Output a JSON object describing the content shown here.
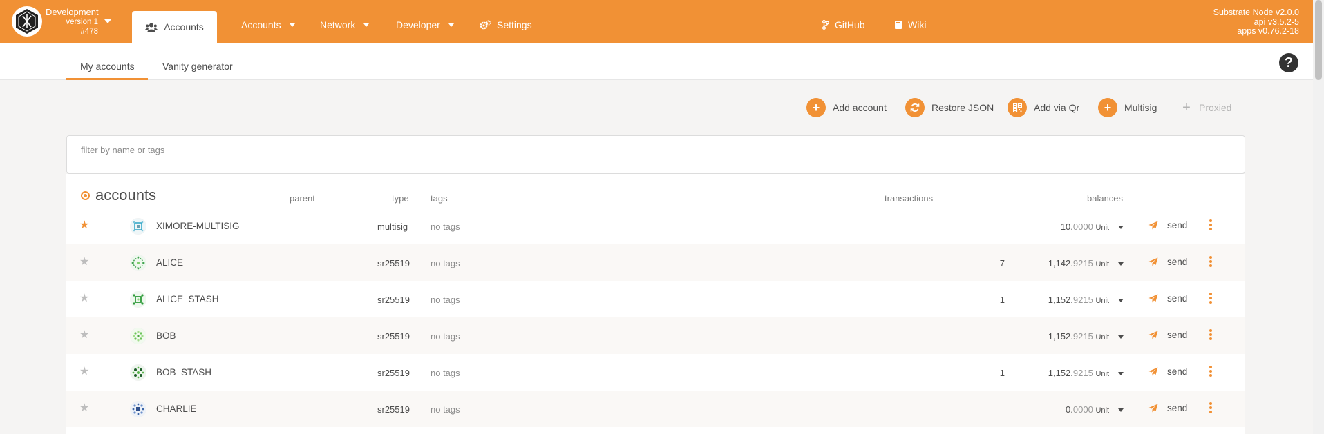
{
  "header": {
    "chain_name": "Development",
    "chain_version": "version 1",
    "chain_block": "#478",
    "nav": [
      {
        "label": "Accounts",
        "active": true
      },
      {
        "label": "Accounts"
      },
      {
        "label": "Network"
      },
      {
        "label": "Developer"
      },
      {
        "label": "Settings"
      },
      {
        "label": "GitHub"
      },
      {
        "label": "Wiki"
      }
    ],
    "node_lines": [
      "Substrate Node v2.0.0",
      "api v3.5.2-5",
      "apps v0.76.2-18"
    ]
  },
  "subtabs": [
    "My accounts",
    "Vanity generator"
  ],
  "help_label": "?",
  "actions": [
    {
      "label": "Add account",
      "icon": "plus-icon"
    },
    {
      "label": "Restore JSON",
      "icon": "sync-icon"
    },
    {
      "label": "Add via Qr",
      "icon": "qrcode-icon"
    },
    {
      "label": "Multisig",
      "icon": "plus-icon"
    },
    {
      "label": "Proxied",
      "icon": "plus-icon",
      "disabled": true
    }
  ],
  "filter": {
    "placeholder": "filter by name or tags",
    "value": ""
  },
  "table": {
    "headers": {
      "accounts": "accounts",
      "parent": "parent",
      "type": "type",
      "tags": "tags",
      "transactions": "transactions",
      "balances": "balances"
    },
    "rows": [
      {
        "name": "XIMORE-MULTISIG",
        "type": "multisig",
        "tags": "no tags",
        "transactions": "",
        "balance_int": "10.",
        "balance_dec": "0000",
        "unit": "Unit",
        "starred": true,
        "send": "send"
      },
      {
        "name": "ALICE",
        "type": "sr25519",
        "tags": "no tags",
        "transactions": "7",
        "balance_int": "1,142.",
        "balance_dec": "9215",
        "unit": "Unit",
        "starred": false,
        "send": "send"
      },
      {
        "name": "ALICE_STASH",
        "type": "sr25519",
        "tags": "no tags",
        "transactions": "1",
        "balance_int": "1,152.",
        "balance_dec": "9215",
        "unit": "Unit",
        "starred": false,
        "send": "send"
      },
      {
        "name": "BOB",
        "type": "sr25519",
        "tags": "no tags",
        "transactions": "",
        "balance_int": "1,152.",
        "balance_dec": "9215",
        "unit": "Unit",
        "starred": false,
        "send": "send"
      },
      {
        "name": "BOB_STASH",
        "type": "sr25519",
        "tags": "no tags",
        "transactions": "1",
        "balance_int": "1,152.",
        "balance_dec": "9215",
        "unit": "Unit",
        "starred": false,
        "send": "send"
      },
      {
        "name": "CHARLIE",
        "type": "sr25519",
        "tags": "no tags",
        "transactions": "",
        "balance_int": "0.",
        "balance_dec": "0000",
        "unit": "Unit",
        "starred": false,
        "send": "send"
      }
    ]
  },
  "colors": {
    "accent": "#f19135",
    "background": "#f5f4f3",
    "row_alt": "#faf8f6"
  }
}
